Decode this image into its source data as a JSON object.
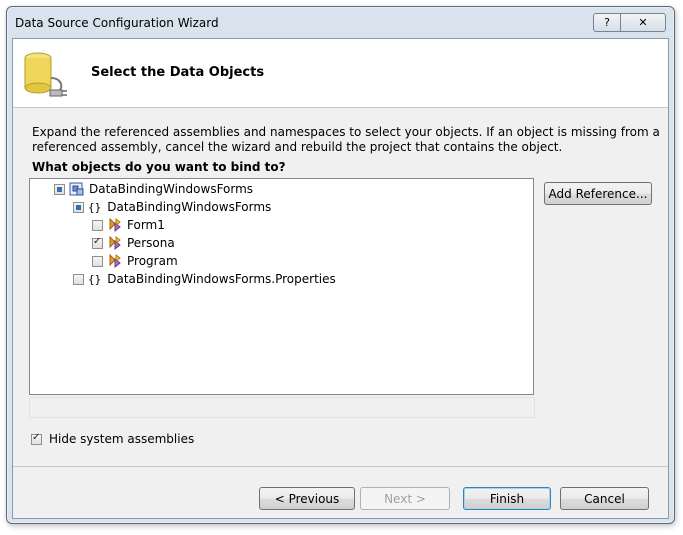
{
  "window": {
    "title": "Data Source Configuration Wizard",
    "help_label": "?",
    "close_label": "✕"
  },
  "header": {
    "title": "Select the Data Objects"
  },
  "description": "Expand the referenced assemblies and namespaces to select your objects. If an object is missing from a referenced assembly, cancel the wizard and rebuild the project that contains the object.",
  "question": "What objects do you want to bind to?",
  "tree": {
    "items": [
      {
        "label": "DataBindingWindowsForms",
        "level": 0,
        "state": "partial",
        "icon": "assembly-icon"
      },
      {
        "label": "DataBindingWindowsForms",
        "level": 1,
        "state": "partial",
        "icon": "namespace-icon"
      },
      {
        "label": "Form1",
        "level": 2,
        "state": "unchecked",
        "icon": "class-icon"
      },
      {
        "label": "Persona",
        "level": 2,
        "state": "checked",
        "icon": "class-icon"
      },
      {
        "label": "Program",
        "level": 2,
        "state": "unchecked",
        "icon": "class-icon"
      },
      {
        "label": "DataBindingWindowsForms.Properties",
        "level": 1,
        "state": "unchecked",
        "icon": "namespace-icon"
      }
    ]
  },
  "add_reference_label": "Add Reference...",
  "hide_system": {
    "label": "Hide system assemblies",
    "checked": true
  },
  "buttons": {
    "previous": "< Previous",
    "next": "Next >",
    "finish": "Finish",
    "cancel": "Cancel"
  }
}
